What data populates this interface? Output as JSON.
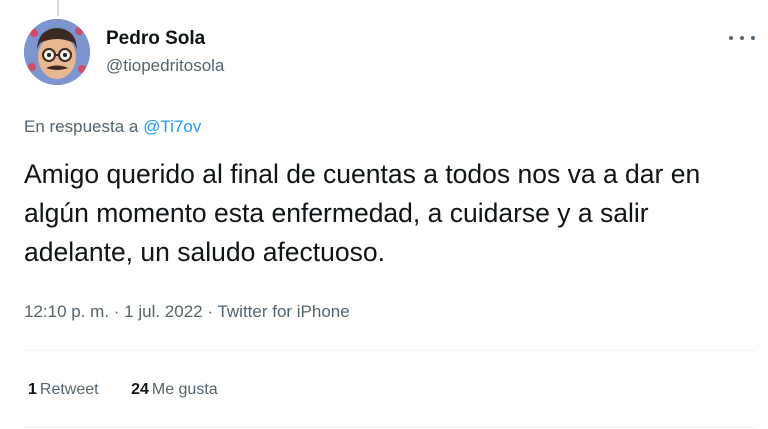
{
  "tweet": {
    "author_name": "Pedro Sola",
    "author_handle": "@tiopedritosola",
    "reply_prefix": "En respuesta a ",
    "reply_to": "@Ti7ov",
    "text": "Amigo querido al final de cuentas a todos nos va a dar en algún momento esta enfermedad, a cuidarse y a salir adelante, un saludo afectuoso.",
    "time": "12:10 p. m.",
    "date": "1 jul. 2022",
    "source": "Twitter for iPhone",
    "separator": " · "
  },
  "stats": {
    "retweets_count": "1",
    "retweets_label": "Retweet",
    "likes_count": "24",
    "likes_label": "Me gusta"
  },
  "icons": {
    "more": "more-options-icon",
    "avatar": "avatar-cartoon-face"
  },
  "colors": {
    "link": "#1d9bf0",
    "secondary_text": "#536471",
    "primary_text": "#0f1419"
  }
}
